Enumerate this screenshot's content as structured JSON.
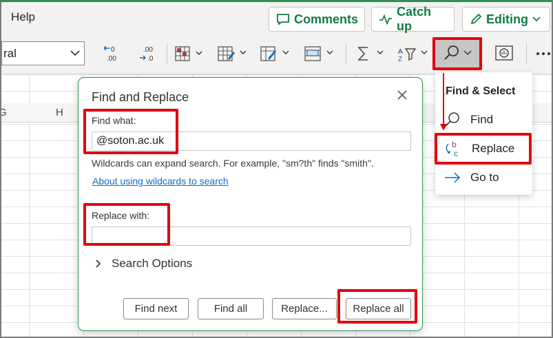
{
  "ribbon": {
    "help_tab": "Help",
    "comments_label": "Comments",
    "catchup_label": "Catch up",
    "editing_label": "Editing",
    "font_value": "ral"
  },
  "grid": {
    "col_g": "G",
    "col_h": "H"
  },
  "dialog": {
    "title": "Find and Replace",
    "find_label": "Find what:",
    "find_value": "@soton.ac.uk",
    "hint": "Wildcards can expand search. For example, \"sm?th\" finds \"smith\".",
    "link": "About using wildcards to search",
    "replace_label": "Replace with:",
    "replace_value": "",
    "search_options": "Search Options",
    "buttons": {
      "find_next": "Find next",
      "find_all": "Find all",
      "replace": "Replace...",
      "replace_all": "Replace all"
    }
  },
  "menu": {
    "title": "Find & Select",
    "items": [
      {
        "label": "Find",
        "icon": "search-icon"
      },
      {
        "label": "Replace",
        "icon": "replace-icon"
      },
      {
        "label": "Go to",
        "icon": "arrow-right-icon"
      }
    ]
  },
  "colors": {
    "accent_green": "#107c41",
    "annotation_red": "#e3000f",
    "link_blue": "#0f6cbd"
  }
}
